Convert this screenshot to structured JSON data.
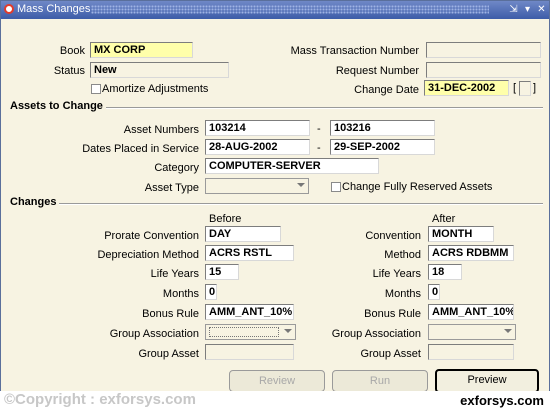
{
  "window": {
    "title": "Mass Changes",
    "controls": [
      "⇲",
      "▾",
      "✕"
    ]
  },
  "header": {
    "book_label": "Book",
    "book_value": "MX CORP",
    "status_label": "Status",
    "status_value": "New",
    "amortize_label": "Amortize Adjustments",
    "mass_txn_label": "Mass Transaction Number",
    "mass_txn_value": "",
    "request_label": "Request Number",
    "request_value": "",
    "change_date_label": "Change Date",
    "change_date_value": "31-DEC-2002",
    "bracket_open": "[",
    "bracket_close": "]"
  },
  "assets": {
    "section_title": "Assets to Change",
    "asset_numbers_label": "Asset Numbers",
    "asset_from": "103214",
    "asset_to": "103216",
    "dates_label": "Dates Placed in Service",
    "date_from": "28-AUG-2002",
    "date_to": "29-SEP-2002",
    "dash": "-",
    "category_label": "Category",
    "category_value": "COMPUTER-SERVER",
    "asset_type_label": "Asset Type",
    "change_fully_label": "Change Fully Reserved Assets"
  },
  "changes": {
    "section_title": "Changes",
    "before_label": "Before",
    "after_label": "After",
    "prorate_label": "Prorate Convention",
    "prorate_value": "DAY",
    "convention_label": "Convention",
    "convention_value": "MONTH",
    "dep_method_label": "Depreciation Method",
    "dep_method_value": "ACRS RSTL",
    "method_label": "Method",
    "method_value": "ACRS RDBMM",
    "life_before_label": "Life Years",
    "life_before_value": "15",
    "life_after_label": "Life Years",
    "life_after_value": "18",
    "months_before_label": "Months",
    "months_before_value": "0",
    "months_after_label": "Months",
    "months_after_value": "0",
    "bonus_before_label": "Bonus Rule",
    "bonus_before_value": "AMM_ANT_10%",
    "bonus_after_label": "Bonus Rule",
    "bonus_after_value": "AMM_ANT_10%",
    "group_assoc_before_label": "Group Association",
    "group_assoc_after_label": "Group Association",
    "group_asset_before_label": "Group Asset",
    "group_asset_after_label": "Group Asset"
  },
  "buttons": {
    "review": "Review",
    "run": "Run",
    "preview": "Preview"
  },
  "footer": {
    "copyright": "©Copyright : exforsys.com",
    "site": "exforsys.com"
  }
}
